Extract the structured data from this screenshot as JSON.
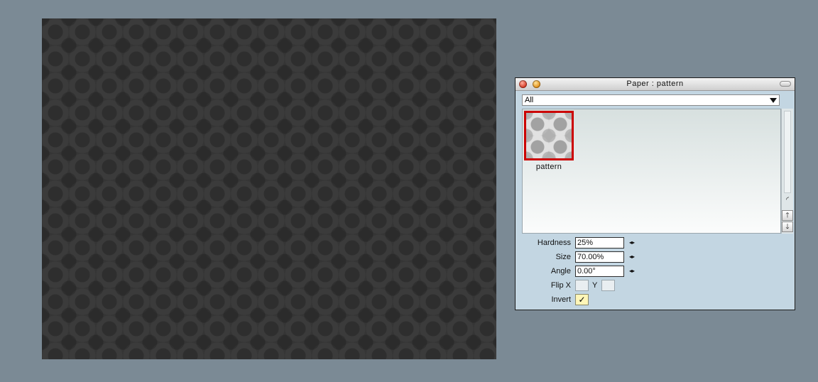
{
  "canvas": {
    "pattern": "dark-circle-pattern"
  },
  "panel": {
    "title": "Paper : pattern",
    "category": "All",
    "items": [
      {
        "label": "pattern",
        "selected": true
      }
    ],
    "hardness": {
      "label": "Hardness",
      "value": "25%"
    },
    "size": {
      "label": "Size",
      "value": "70.00%"
    },
    "angle": {
      "label": "Angle",
      "value": "0.00°"
    },
    "flip": {
      "label_x": "Flip X",
      "label_y": "Y",
      "x_checked": false,
      "y_checked": false
    },
    "invert": {
      "label": "Invert",
      "checked": true,
      "check_glyph": "✓"
    }
  },
  "icons": {
    "stepper": "◂▸",
    "scroll_up": "🡑",
    "scroll_down": "🡓",
    "scroll_corner": "◜"
  },
  "colors": {
    "background": "#7b8a95",
    "panel": "#c3d6e2",
    "selection": "#cc0000"
  }
}
